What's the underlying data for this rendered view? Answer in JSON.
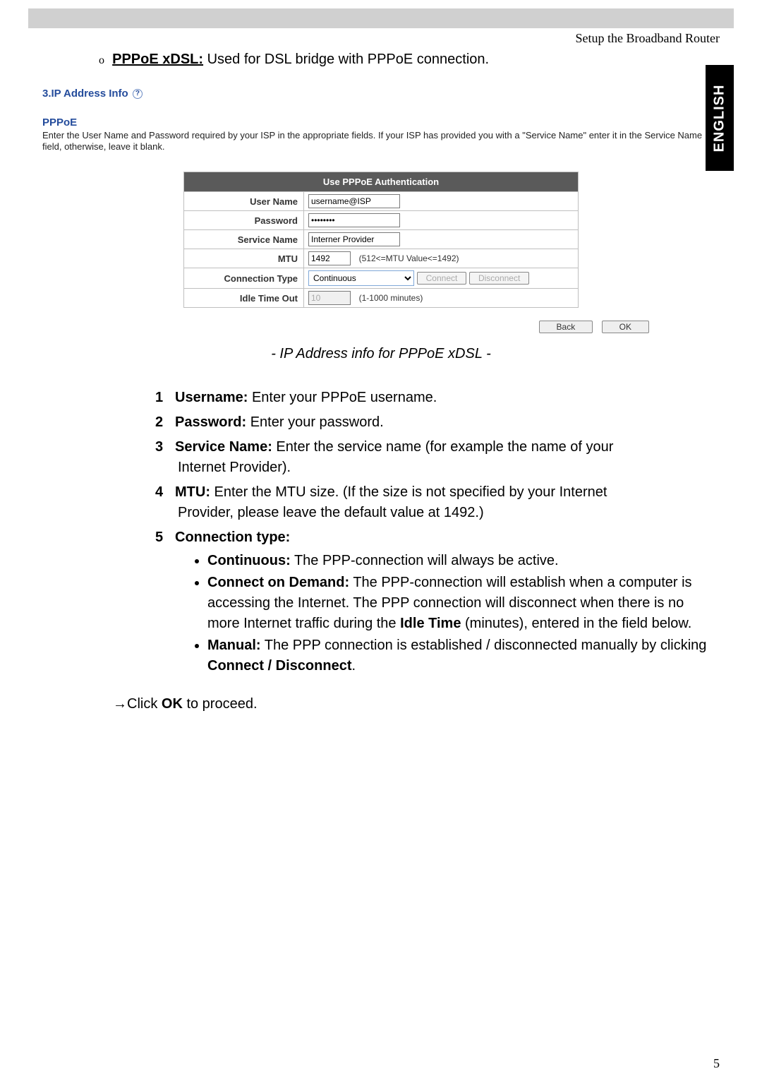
{
  "header": {
    "title": "Setup the Broadband Router"
  },
  "sideTab": "ENGLISH",
  "intro": {
    "bullet": "o",
    "label": "PPPoE xDSL:",
    "text": " Used for DSL bridge with PPPoE connection."
  },
  "section": {
    "number": "3.",
    "title": "IP Address Info",
    "helpGlyph": "?"
  },
  "pppoe": {
    "title": "PPPoE",
    "desc": "Enter the User Name and Password required by your ISP in the appropriate fields. If your ISP has provided you with a \"Service Name\" enter it in the Service Name field, otherwise, leave it blank."
  },
  "form": {
    "header": "Use PPPoE Authentication",
    "rows": {
      "username": {
        "label": "User Name",
        "value": "username@ISP"
      },
      "password": {
        "label": "Password",
        "value": "••••••••"
      },
      "service": {
        "label": "Service Name",
        "value": "Interner Provider"
      },
      "mtu": {
        "label": "MTU",
        "value": "1492",
        "hint": "(512<=MTU Value<=1492)"
      },
      "conntype": {
        "label": "Connection Type",
        "value": "Continuous",
        "connect": "Connect",
        "disconnect": "Disconnect"
      },
      "idle": {
        "label": "Idle Time Out",
        "value": "10",
        "hint": "(1-1000 minutes)"
      }
    }
  },
  "actions": {
    "back": "Back",
    "ok": "OK"
  },
  "caption": "- IP Address info for PPPoE xDSL -",
  "doc": {
    "items": [
      {
        "n": "1",
        "label": "Username:",
        "text": " Enter your PPPoE username."
      },
      {
        "n": "2",
        "label": "Password:",
        "text": " Enter your password."
      },
      {
        "n": "3",
        "label": "Service Name:",
        "text": " Enter the service name (for example the name of your",
        "cont": "Internet Provider)."
      },
      {
        "n": "4",
        "label": "MTU:",
        "text": " Enter the MTU size. (If the size is not specified by your Internet",
        "cont": "Provider, please leave the default value at 1492.)"
      },
      {
        "n": "5",
        "label": "Connection type:",
        "text": ""
      }
    ],
    "sub": [
      {
        "label": "Continuous:",
        "text": " The PPP-connection will always be active."
      },
      {
        "label": "Connect on Demand:",
        "text": " The PPP-connection will establish when a computer is accessing the Internet. The PPP connection will disconnect when there is no more Internet traffic during the ",
        "bold2": "Idle Time",
        "tail": " (minutes), entered in the field below."
      },
      {
        "label": "Manual:",
        "text": " The PPP connection is established / disconnected manually by clicking ",
        "bold2": "Connect / Disconnect",
        "tail": "."
      }
    ]
  },
  "proceed": {
    "arrow": "→",
    "pre": "Click ",
    "bold": "OK",
    "post": " to proceed."
  },
  "pageNumber": "5"
}
